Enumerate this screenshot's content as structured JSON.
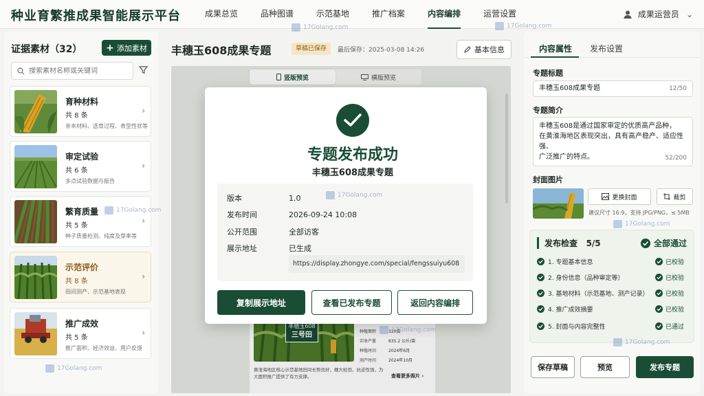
{
  "app": {
    "title": "种业育繁推成果智能展示平台"
  },
  "nav": {
    "items": [
      "成果总览",
      "品种图谱",
      "示范基地",
      "推广档案",
      "内容编排",
      "运营设置"
    ],
    "active_index": 4
  },
  "user": {
    "name": "成果运营员"
  },
  "left": {
    "title": "证据素材（32）",
    "add_label": "添加素材",
    "search_placeholder": "搜索素材名称或关键词",
    "cards": [
      {
        "title": "育种材料",
        "count": "共 8 条",
        "desc": "亲本材料、选育过程、表型性状等"
      },
      {
        "title": "审定试验",
        "count": "共 6 条",
        "desc": "多点试验数据与报告"
      },
      {
        "title": "繁育质量",
        "count": "共 5 条",
        "desc": "种子质量检测、纯度及芽率等"
      },
      {
        "title": "示范评价",
        "count": "共 8 条",
        "desc": "田间测产、示范基地表现"
      },
      {
        "title": "推广成效",
        "count": "共 5 条",
        "desc": "推广面积、经济效益、用户反馈"
      }
    ],
    "active_card": 3
  },
  "center": {
    "title": "丰穗玉608成果专题",
    "badge": "草稿已保存",
    "saved": "最后保存：2025-03-08 14:26",
    "basic_info": "基本信息",
    "preview_tabs": [
      "竖版预览",
      "横版预览"
    ],
    "phone": {
      "sign_line1": "丰穗玉608",
      "sign_line2": "三号田",
      "rows": [
        {
          "k": "种植面积",
          "v": "320亩"
        },
        {
          "k": "实收产量",
          "v": "835.2 公斤/亩"
        },
        {
          "k": "种植时间",
          "v": "2024年6月"
        },
        {
          "k": "测产时间",
          "v": "2024年10月"
        }
      ],
      "note": "黄淮海地区核心示范基地田间长势良好，穗大粒饱，抗逆性强，为大面积推广提供了有力支撑。",
      "more": "查看更多照片"
    }
  },
  "modal": {
    "title": "专题发布成功",
    "subtitle": "丰穗玉608成果专题",
    "rows": [
      {
        "k": "版本",
        "v": "1.0"
      },
      {
        "k": "发布时间",
        "v": "2026-09-24 10:08"
      },
      {
        "k": "公开范围",
        "v": "全部访客"
      },
      {
        "k": "展示地址",
        "v": "已生成"
      }
    ],
    "url": "https://display.zhongye.com/special/fengssuiyu608",
    "buttons": [
      "复制展示地址",
      "查看已发布专题",
      "返回内容编排"
    ]
  },
  "right": {
    "tabs": [
      "内容属性",
      "发布设置"
    ],
    "topic_title_label": "专题标题",
    "topic_title_value": "丰穗玉608成果专题",
    "topic_title_count": "12/50",
    "intro_label": "专题简介",
    "intro_lines": [
      "丰穗玉608是通过国家审定的优质高产品种，",
      "在黄淮海地区表现突出，具有高产稳产、适应性强、",
      "广泛推广的特点。"
    ],
    "intro_count": "52/200",
    "cover_label": "封面图片",
    "replace_cover": "更换封面",
    "crop": "裁剪",
    "cover_hint": "建议尺寸 16:9，支持 JPG/PNG，≤ 5MB",
    "check_title": "发布检查",
    "check_score": "5/5",
    "all_pass": "全部通过",
    "checks": [
      {
        "t": "1. 专题基本信息",
        "s": "已校验"
      },
      {
        "t": "2. 身份信息（品种审定等）",
        "s": "已校验"
      },
      {
        "t": "3. 基地材料（示范基地、测产记录）",
        "s": "已校验"
      },
      {
        "t": "4. 推广成效摘要",
        "s": "已校验"
      },
      {
        "t": "5. 封面与内容完整性",
        "s": "已通过"
      }
    ],
    "save_draft": "保存草稿",
    "preview": "预览",
    "publish": "发布专题"
  },
  "watermark": "17Golang.com",
  "colors": {
    "primary": "#1a4d35",
    "accent_gold": "#8a5a17",
    "badge_bg": "#f6e6c4"
  }
}
